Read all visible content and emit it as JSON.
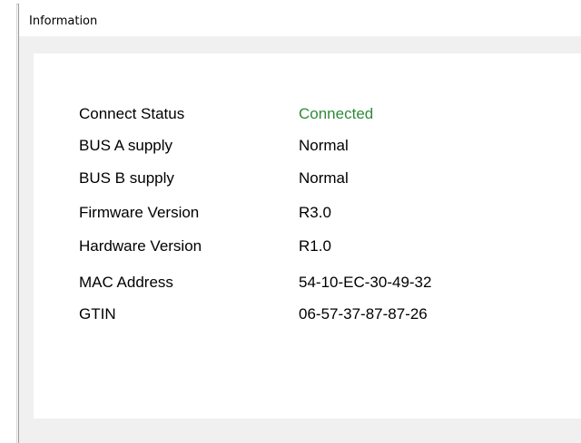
{
  "window": {
    "title": "Information",
    "close_icon": "close-icon"
  },
  "info": {
    "rows": [
      {
        "label": "Connect Status",
        "value": "Connected"
      },
      {
        "label": "BUS A supply",
        "value": "Normal"
      },
      {
        "label": "BUS B supply",
        "value": "Normal"
      },
      {
        "label": "Firmware Version",
        "value": "R3.0"
      },
      {
        "label": "Hardware Version",
        "value": "R1.0"
      },
      {
        "label": "MAC Address",
        "value": "54-10-EC-30-49-32"
      },
      {
        "label": "GTIN",
        "value": "06-57-37-87-87-26"
      }
    ]
  },
  "colors": {
    "status_ok": "#2e8b3a",
    "dialog_bg": "#f0f0f0",
    "panel_bg": "#ffffff"
  }
}
